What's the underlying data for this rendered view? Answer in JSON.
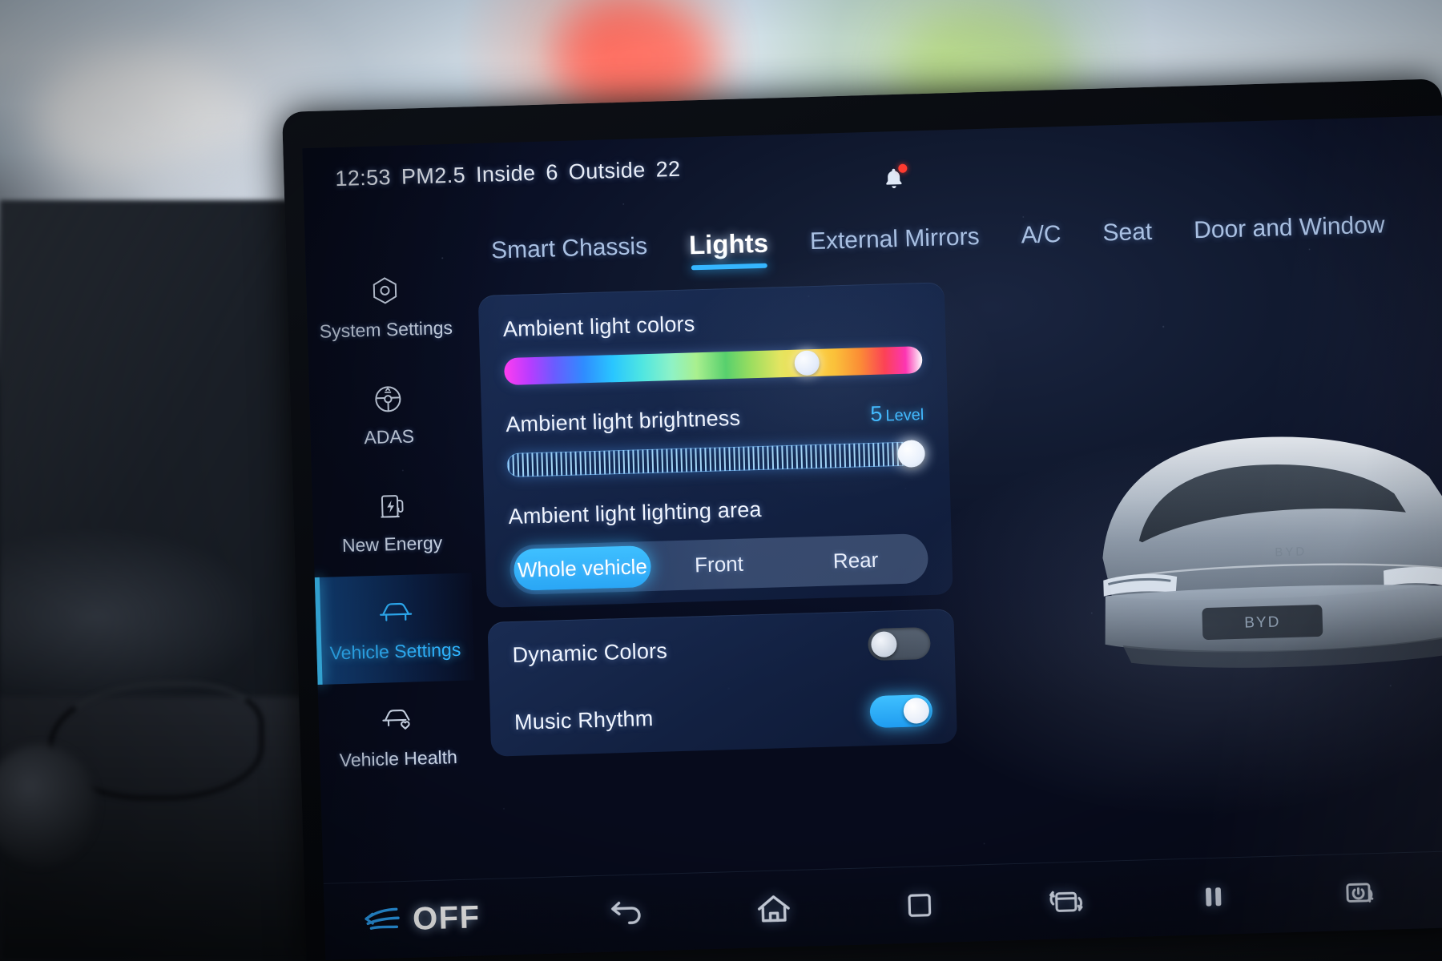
{
  "status_bar": {
    "time": "12:53",
    "pm_label": "PM2.5",
    "inside_label": "Inside",
    "inside_value": "6",
    "outside_label": "Outside",
    "outside_value": "22",
    "notification_icon": "bell-icon",
    "notification_badge": true
  },
  "sidebar": {
    "items": [
      {
        "label": "System Settings",
        "icon": "hex-gear-icon",
        "active": false
      },
      {
        "label": "ADAS",
        "icon": "steering-wheel-icon",
        "active": false
      },
      {
        "label": "New Energy",
        "icon": "charging-station-icon",
        "active": false
      },
      {
        "label": "Vehicle Settings",
        "icon": "car-front-icon",
        "active": true
      },
      {
        "label": "Vehicle Health",
        "icon": "car-heart-icon",
        "active": false
      }
    ]
  },
  "tabs": [
    {
      "label": "Smart Chassis",
      "active": false
    },
    {
      "label": "Lights",
      "active": true
    },
    {
      "label": "External Mirrors",
      "active": false
    },
    {
      "label": "A/C",
      "active": false
    },
    {
      "label": "Seat",
      "active": false
    },
    {
      "label": "Door and Window",
      "active": false
    }
  ],
  "ambient_card": {
    "colors": {
      "label": "Ambient light colors",
      "knob_position_percent": 72.5
    },
    "brightness": {
      "label": "Ambient light brightness",
      "value": "5",
      "unit": "Level",
      "knob_position_percent": 97
    },
    "lighting_area": {
      "label": "Ambient light lighting area",
      "options": [
        {
          "label": "Whole vehicle",
          "active": true
        },
        {
          "label": "Front",
          "active": false
        },
        {
          "label": "Rear",
          "active": false
        }
      ]
    }
  },
  "toggles_card": {
    "rows": [
      {
        "label": "Dynamic Colors",
        "state": "off"
      },
      {
        "label": "Music Rhythm",
        "state": "on"
      }
    ]
  },
  "bottom_bar": {
    "off_button": {
      "label": "OFF",
      "icon": "defrost-airflow-icon"
    },
    "nav_icons": [
      {
        "name": "back-icon"
      },
      {
        "name": "home-icon"
      },
      {
        "name": "recent-apps-icon"
      },
      {
        "name": "rotate-screen-icon"
      },
      {
        "name": "pause-icon"
      },
      {
        "name": "screen-power-icon"
      }
    ]
  },
  "colors": {
    "accent": "#3ec6ff",
    "active_tab_underline": "#35b6ff",
    "toggle_on": "#2aa6f5",
    "badge_red": "#ff3b30",
    "card_bg": "#1e3460",
    "screen_bg": "#0a1026"
  }
}
